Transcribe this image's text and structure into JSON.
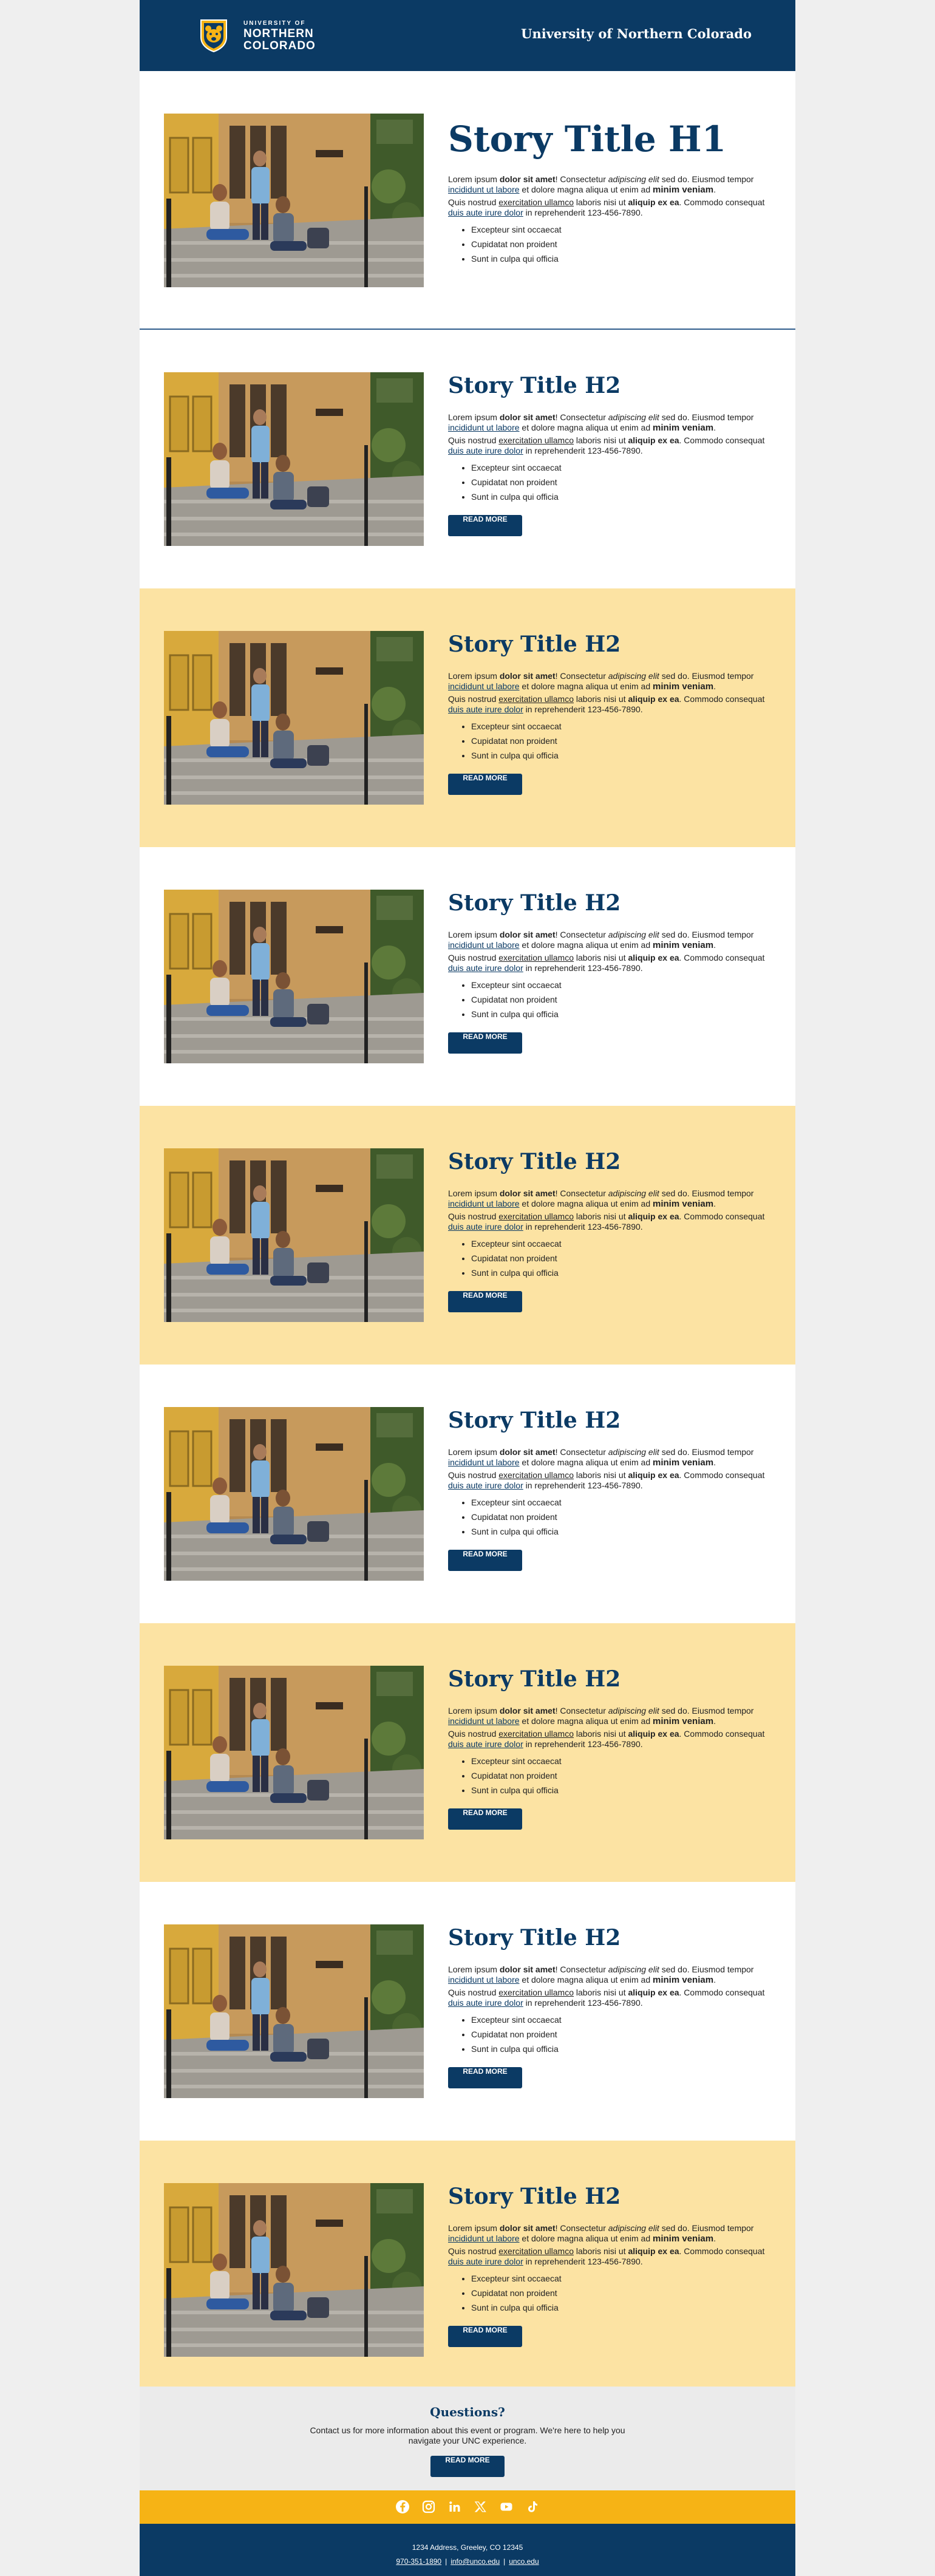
{
  "header": {
    "logo_line1": "UNIVERSITY OF",
    "logo_line2": "NORTHERN",
    "logo_line3": "COLORADO",
    "title": "University of Northern Colorado"
  },
  "story_text": {
    "p1_a": "Lorem ipsum ",
    "p1_b": "dolor sit amet",
    "p1_c": "! Consectetur ",
    "p1_d": "adipiscing elit",
    "p1_e": " sed do. Eiusmod tempor ",
    "p1_f": "incididunt ut labore",
    "p1_g": " et dolore magna aliqua ut enim ad ",
    "p1_h": "minim veniam",
    "p1_i": ".",
    "p2_a": "Quis nostrud ",
    "p2_b": "exercitation ullamco",
    "p2_c": " laboris nisi ut ",
    "p2_d": "aliquip ex ea",
    "p2_e": ". Commodo consequat ",
    "p2_f": "duis aute irure dolor",
    "p2_g": " in reprehenderit 123-456-7890.",
    "bullets": [
      "Excepteur sint occaecat",
      "Cupidatat non proident",
      "Sunt in culpa qui officia"
    ],
    "button": "READ MORE"
  },
  "stories": [
    {
      "title": "Story Title H1",
      "background": "#ffffff"
    },
    {
      "title": "Story Title H2",
      "background": "#ffffff"
    },
    {
      "title": "Story Title H2",
      "background": "#fce3a3"
    },
    {
      "title": "Story Title H2",
      "background": "#ffffff"
    },
    {
      "title": "Story Title H2",
      "background": "#fce3a3"
    },
    {
      "title": "Story Title H2",
      "background": "#ffffff"
    },
    {
      "title": "Story Title H2",
      "background": "#fce3a3"
    },
    {
      "title": "Story Title H2",
      "background": "#ffffff"
    },
    {
      "title": "Story Title H2",
      "background": "#fce3a3"
    }
  ],
  "questions": {
    "title": "Questions?",
    "text": "Contact us for more information about this event or program. We're here to help you navigate your UNC experience.",
    "button": "READ MORE"
  },
  "social": [
    "facebook-icon",
    "instagram-icon",
    "linkedin-icon",
    "x-icon",
    "youtube-icon",
    "tiktok-icon"
  ],
  "footer": {
    "address": "1234 Address, Greeley, CO 12345",
    "phone": "970-351-1890",
    "email": "info@unco.edu",
    "website": "unco.edu",
    "separator": "|"
  },
  "colors": {
    "navy": "#0b3a64",
    "gold": "#f6b315",
    "cream": "#fce3a3",
    "gray": "#ebebeb"
  }
}
